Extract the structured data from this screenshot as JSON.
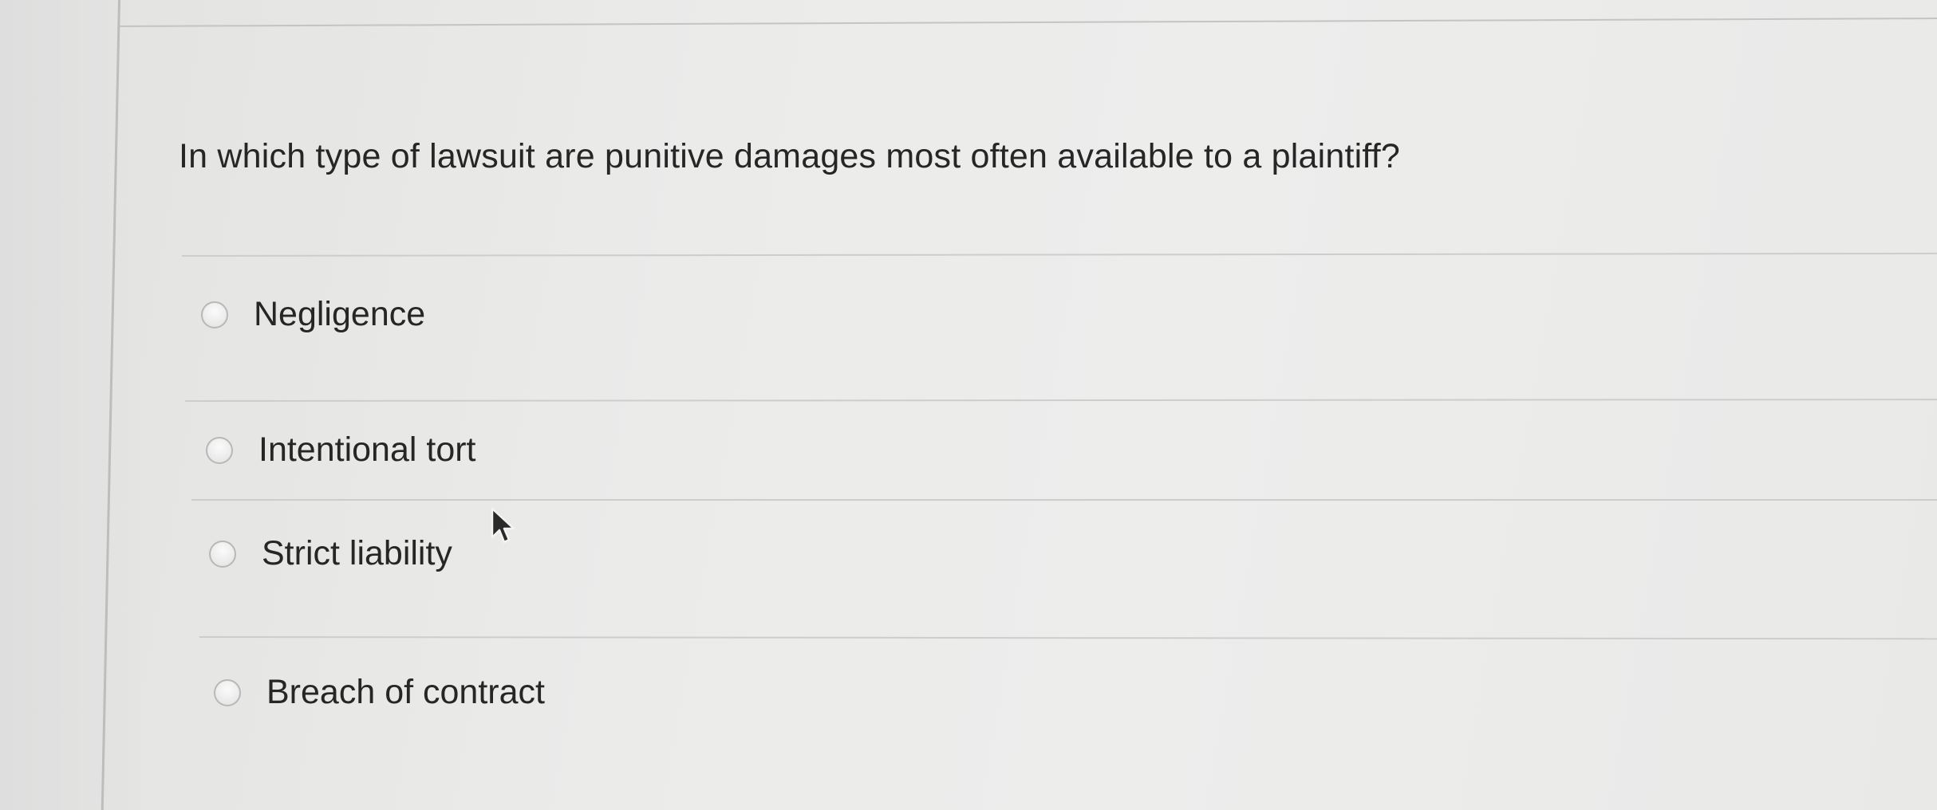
{
  "question": {
    "text": "In which type of lawsuit are punitive damages most often available to a plaintiff?"
  },
  "options": [
    {
      "label": "Negligence",
      "selected": false
    },
    {
      "label": "Intentional tort",
      "selected": false
    },
    {
      "label": "Strict liability",
      "selected": false
    },
    {
      "label": "Breach of contract",
      "selected": false
    }
  ],
  "icons": {
    "radio": "radio-unselected-icon",
    "cursor": "mouse-pointer-icon"
  },
  "colors": {
    "text": "#262626",
    "background": "#ebebea",
    "divider": "#cdcdcc"
  }
}
